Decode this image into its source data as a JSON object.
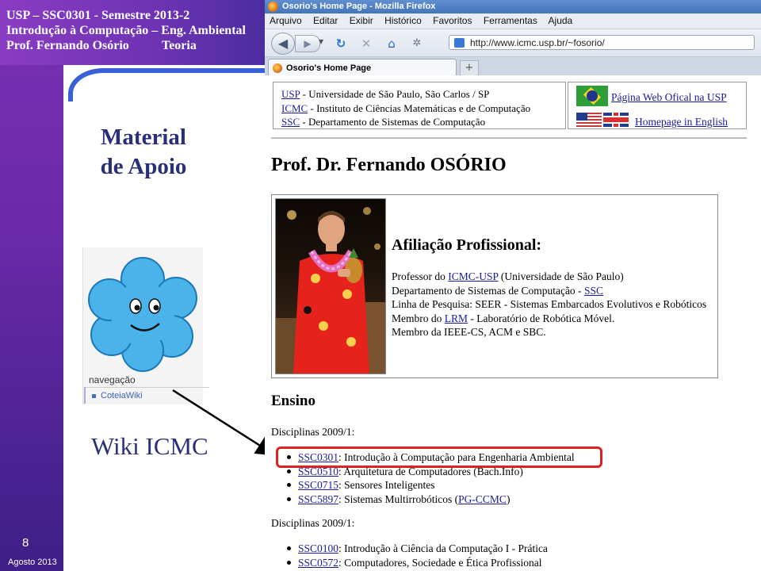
{
  "slide": {
    "header_line1": "USP – SSC0301 - Semestre 2013-2",
    "header_line2": "Introdução à Computação – Eng. Ambiental",
    "header_line3": "Prof. Fernando Osório",
    "header_teoria": "Teoria",
    "title_line1": "Material",
    "title_line2": "de Apoio",
    "wiki_nav_label": "navegação",
    "wiki_nav_link": "CoteiaWiki",
    "wiki_title": "Wiki ICMC",
    "slide_number": "8",
    "date": "Agosto 2013"
  },
  "browser": {
    "window_title": "Osorio's Home Page - Mozilla Firefox",
    "menu": [
      "Arquivo",
      "Editar",
      "Exibir",
      "Histórico",
      "Favoritos",
      "Ferramentas",
      "Ajuda"
    ],
    "url": "http://www.icmc.usp.br/~fosorio/",
    "tab_title": "Osorio's Home Page",
    "newtab_symbol": "+"
  },
  "page": {
    "top_links": [
      {
        "abbr": "USP",
        "desc": " - Universidade de São Paulo, São Carlos / SP"
      },
      {
        "abbr": "ICMC",
        "desc": " - Instituto de Ciências Matemáticas e de Computação"
      },
      {
        "abbr": "SSC",
        "desc": " - Departamento de Sistemas de Computação"
      }
    ],
    "flag_link1": "Página Web Ofical na USP",
    "flag_link2": "Homepage in English",
    "prof_name": "Prof. Dr. Fernando OSÓRIO",
    "affiliation_title": "Afiliação Profissional:",
    "aff": {
      "l1_pre": "Professor do ",
      "l1_link": "ICMC-USP",
      "l1_post": " (Universidade de São Paulo)",
      "l2_pre": "Departamento de Sistemas de Computação - ",
      "l2_link": "SSC",
      "l3": "Linha de Pesquisa: SEER - Sistemas Embarcados Evolutivos e Robóticos",
      "l4_pre": "Membro do ",
      "l4_link": "LRM",
      "l4_post": " - Laboratório de Robótica Móvel.",
      "l5": "Membro da IEEE-CS, ACM e SBC."
    },
    "ensino_title": "Ensino",
    "disc_head1": "Disciplinas 2009/1:",
    "disc1": [
      {
        "code": "SSC0301",
        "name": ": Introdução à Computação para Engenharia Ambiental"
      },
      {
        "code": "SSC0510",
        "name": ": Arquitetura de Computadores (Bach.Info)"
      },
      {
        "code": "SSC0715",
        "name": ": Sensores Inteligentes"
      },
      {
        "code": "SSC5897",
        "name": ": Sistemas Multirrobóticos (",
        "extra_link": "PG-CCMC",
        "tail": ")"
      }
    ],
    "disc_head2": "Disciplinas 2009/1:",
    "disc2": [
      {
        "code": "SSC0100",
        "name": ": Introdução à Ciência da Computação I - Prática"
      },
      {
        "code": "SSC0572",
        "name": ": Computadores, Sociedade e Ética Profissional"
      }
    ]
  },
  "colors": {
    "slide_purple": "#6d33b4",
    "slide_title": "#2a2f7a",
    "link": "#1a1a9e",
    "highlight": "#d22222"
  }
}
